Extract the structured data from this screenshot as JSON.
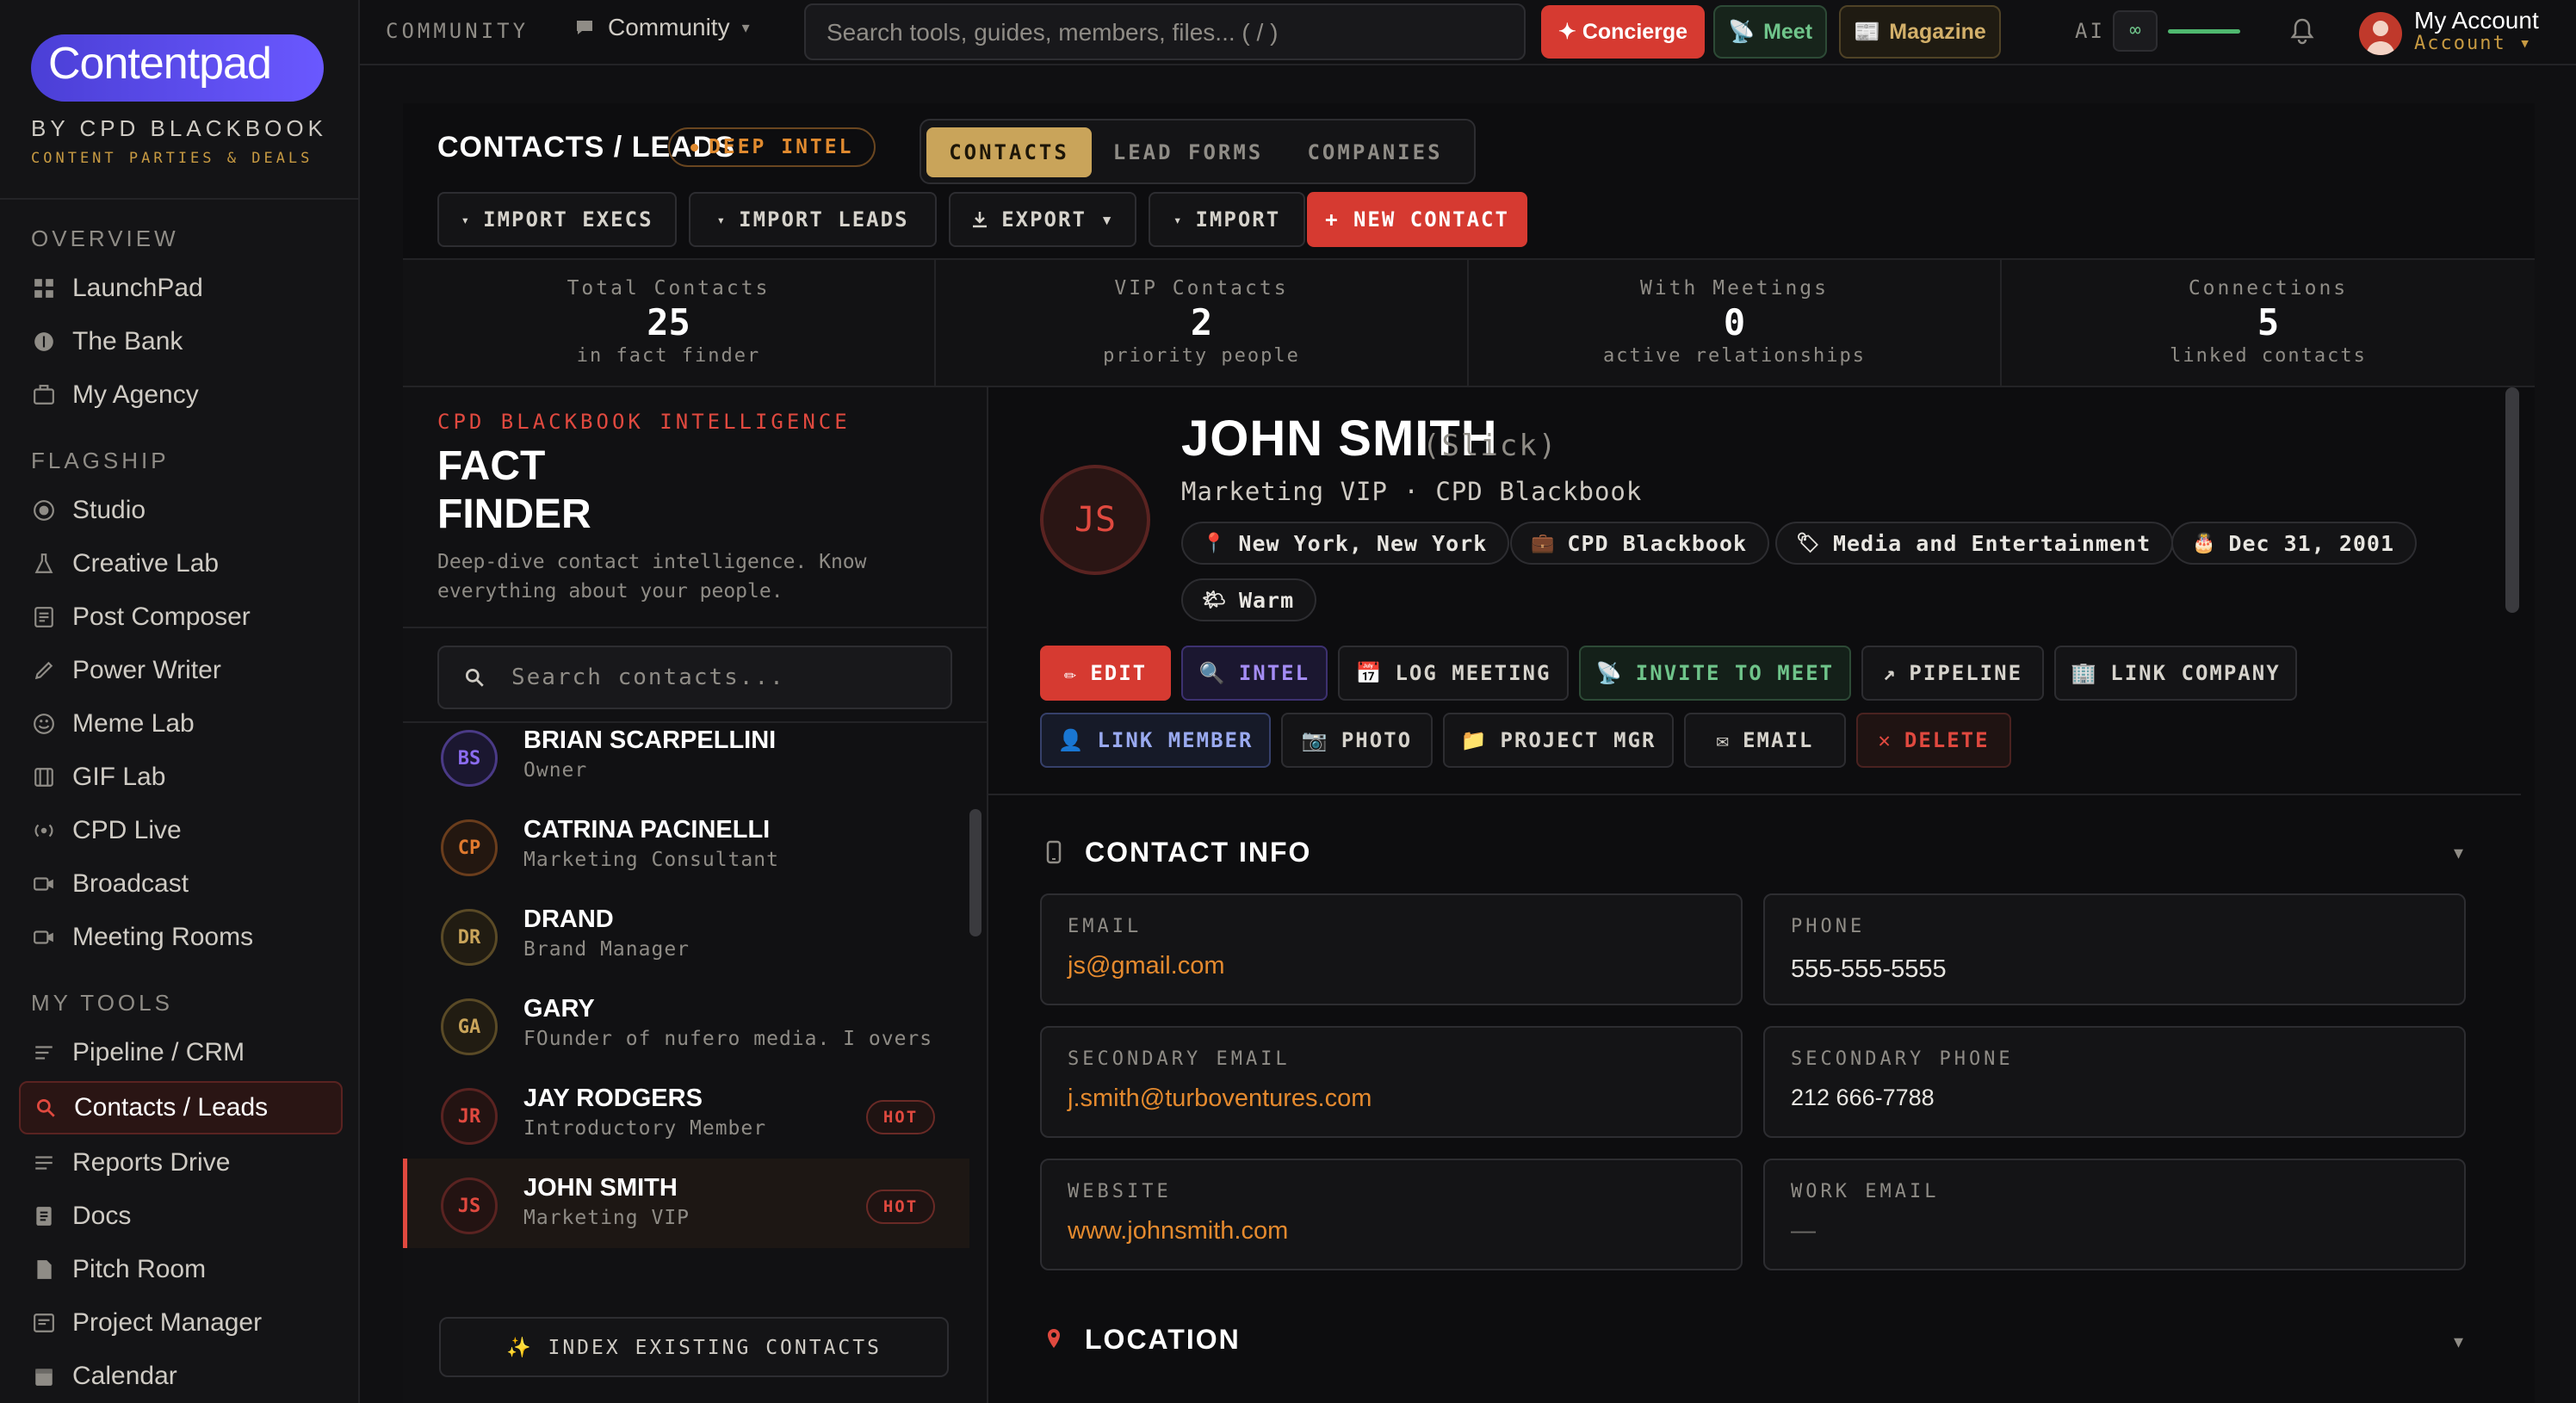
{
  "brand": {
    "logo": "Contentpad",
    "by": "BY CPD BLACKBOOK",
    "tagline": "CONTENT PARTIES & DEALS"
  },
  "sidebar": {
    "sections": [
      {
        "title": "OVERVIEW",
        "items": [
          {
            "label": "LaunchPad",
            "icon": "grid-icon"
          },
          {
            "label": "The Bank",
            "icon": "coin-icon"
          },
          {
            "label": "My Agency",
            "icon": "briefcase-icon"
          }
        ]
      },
      {
        "title": "FLAGSHIP",
        "items": [
          {
            "label": "Studio",
            "icon": "record-icon"
          },
          {
            "label": "Creative Lab",
            "icon": "flask-icon"
          },
          {
            "label": "Post Composer",
            "icon": "document-icon"
          },
          {
            "label": "Power Writer",
            "icon": "pen-icon"
          },
          {
            "label": "Meme Lab",
            "icon": "smiley-icon"
          },
          {
            "label": "GIF Lab",
            "icon": "film-icon"
          },
          {
            "label": "CPD Live",
            "icon": "broadcast-icon"
          },
          {
            "label": "Broadcast",
            "icon": "camera-icon"
          },
          {
            "label": "Meeting Rooms",
            "icon": "video-icon"
          }
        ]
      },
      {
        "title": "MY TOOLS",
        "items": [
          {
            "label": "Pipeline / CRM",
            "icon": "lines-icon"
          },
          {
            "label": "Contacts / Leads",
            "icon": "search-icon",
            "active": true
          },
          {
            "label": "Reports Drive",
            "icon": "lines-icon"
          },
          {
            "label": "Docs",
            "icon": "doc-icon"
          },
          {
            "label": "Pitch Room",
            "icon": "file-icon"
          },
          {
            "label": "Project Manager",
            "icon": "board-icon"
          },
          {
            "label": "Calendar",
            "icon": "calendar-icon"
          }
        ]
      }
    ]
  },
  "topbar": {
    "community_label": "COMMUNITY",
    "community_menu": "Community",
    "search_placeholder": "Search tools, guides, members, files...   ( / )",
    "concierge": "✦ Concierge",
    "meet": "Meet",
    "magazine": "Magazine",
    "ai_label": "AI",
    "ai_value": "∞",
    "account_name": "My Account",
    "account_sub": "Account ▾"
  },
  "header": {
    "title": "CONTACTS / LEADS",
    "badge": "DEEP INTEL",
    "tabs": [
      "CONTACTS",
      "LEAD FORMS",
      "COMPANIES"
    ],
    "active_tab": "CONTACTS",
    "actions": [
      "IMPORT EXECS",
      "IMPORT LEADS",
      "EXPORT ▾",
      "IMPORT",
      "+ NEW CONTACT"
    ]
  },
  "stats": [
    {
      "title": "Total Contacts",
      "value": "25",
      "sub": "in fact finder"
    },
    {
      "title": "VIP Contacts",
      "value": "2",
      "sub": "priority people"
    },
    {
      "title": "With Meetings",
      "value": "0",
      "sub": "active relationships"
    },
    {
      "title": "Connections",
      "value": "5",
      "sub": "linked contacts"
    }
  ],
  "factfinder": {
    "kicker": "CPD BLACKBOOK INTELLIGENCE",
    "title": "FACT FINDER",
    "desc": "Deep-dive contact intelligence. Know everything about your people.",
    "search_placeholder": "Search contacts...",
    "index_button": "✨  INDEX EXISTING CONTACTS"
  },
  "contacts": [
    {
      "initials": "BS",
      "name": "BRIAN SCARPELLINI",
      "role": "Owner",
      "color": "#8b6cf0",
      "hot": ""
    },
    {
      "initials": "CP",
      "name": "CATRINA PACINELLI",
      "role": "Marketing Consultant",
      "color": "#e07a2e",
      "hot": ""
    },
    {
      "initials": "DR",
      "name": "DRAND",
      "role": "Brand Manager",
      "color": "#c9a45a",
      "hot": ""
    },
    {
      "initials": "GA",
      "name": "GARY",
      "role": "FOunder of nufero media. I overs...",
      "color": "#c9a45a",
      "hot": ""
    },
    {
      "initials": "JR",
      "name": "JAY RODGERS",
      "role": "Introductory Member",
      "color": "#e0493f",
      "hot": "HOT"
    },
    {
      "initials": "JS",
      "name": "JOHN SMITH",
      "role": "Marketing VIP",
      "color": "#e0493f",
      "hot": "HOT",
      "selected": true
    }
  ],
  "profile": {
    "initials": "JS",
    "name": "JOHN SMITH",
    "nickname": "(Slick)",
    "role_line": "Marketing VIP · CPD Blackbook",
    "chips": [
      {
        "emoji": "📍",
        "label": "New York, New York"
      },
      {
        "emoji": "💼",
        "label": "CPD Blackbook"
      },
      {
        "emoji": "🏷",
        "label": "Media and Entertainment"
      },
      {
        "emoji": "🎂",
        "label": "Dec 31, 2001"
      },
      {
        "emoji": "🌤",
        "label": "Warm"
      }
    ],
    "buttons_row1": [
      {
        "emoji": "✏",
        "label": "EDIT"
      },
      {
        "emoji": "🔍",
        "label": "INTEL"
      },
      {
        "emoji": "📅",
        "label": "LOG MEETING"
      },
      {
        "emoji": "📡",
        "label": "INVITE TO MEET"
      },
      {
        "emoji": "↗",
        "label": "PIPELINE"
      },
      {
        "emoji": "🏢",
        "label": "LINK COMPANY"
      }
    ],
    "buttons_row2": [
      {
        "emoji": "👤",
        "label": "LINK MEMBER"
      },
      {
        "emoji": "📷",
        "label": "PHOTO"
      },
      {
        "emoji": "📁",
        "label": "PROJECT MGR"
      },
      {
        "emoji": "✉",
        "label": "EMAIL"
      },
      {
        "emoji": "✕",
        "label": "DELETE"
      }
    ]
  },
  "contact_info": {
    "title": "CONTACT INFO",
    "fields": [
      {
        "label": "EMAIL",
        "value": "js@gmail.com",
        "kind": "link"
      },
      {
        "label": "PHONE",
        "value": "555-555-5555",
        "kind": "text"
      },
      {
        "label": "SECONDARY EMAIL",
        "value": "j.smith@turboventures.com",
        "kind": "link"
      },
      {
        "label": "SECONDARY PHONE",
        "value": "212 666-7788",
        "kind": "text"
      },
      {
        "label": "WEBSITE",
        "value": "www.johnsmith.com",
        "kind": "link"
      },
      {
        "label": "WORK EMAIL",
        "value": "—",
        "kind": "dim"
      }
    ]
  },
  "location": {
    "title": "LOCATION"
  },
  "colors": {
    "accent_red": "#e0493f",
    "gold": "#c9a45a",
    "link_orange": "#e58a2e",
    "success_green": "#4fb86f"
  }
}
